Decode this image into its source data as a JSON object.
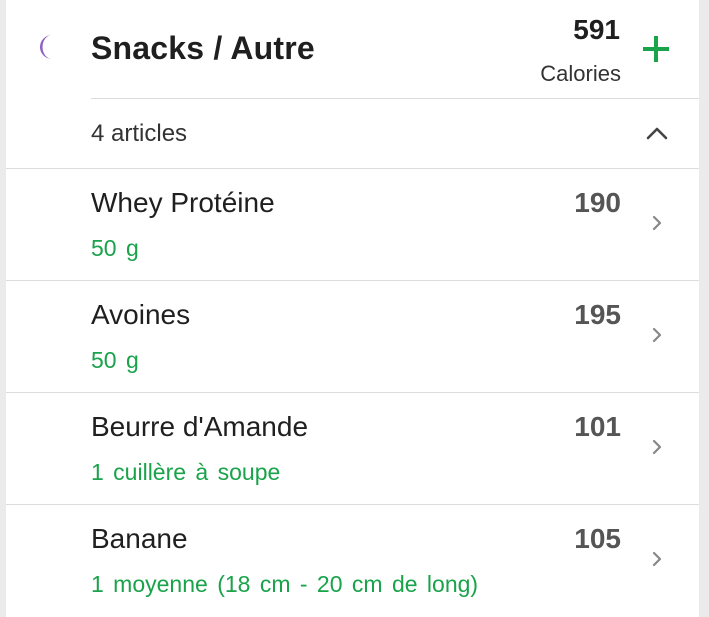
{
  "meal": {
    "title": "Snacks / Autre",
    "icon": "moon-icon",
    "total_calories": "591",
    "calories_label": "Calories",
    "add_icon": "plus-icon"
  },
  "summary": {
    "items_count_label": "4 articles",
    "collapse_icon": "chevron-up-icon"
  },
  "foods": [
    {
      "name": "Whey Protéine",
      "serving": "50  g",
      "calories": "190"
    },
    {
      "name": "Avoines",
      "serving": "50  g",
      "calories": "195"
    },
    {
      "name": "Beurre d'Amande",
      "serving": "1  cuillère à soupe",
      "calories": "101"
    },
    {
      "name": "Banane",
      "serving": "1  moyenne (18 cm - 20 cm de long)",
      "calories": "105"
    }
  ],
  "colors": {
    "accent_green": "#19a34a",
    "moon_purple": "#8e5fc2",
    "background": "#ebebeb",
    "card": "#ffffff"
  }
}
